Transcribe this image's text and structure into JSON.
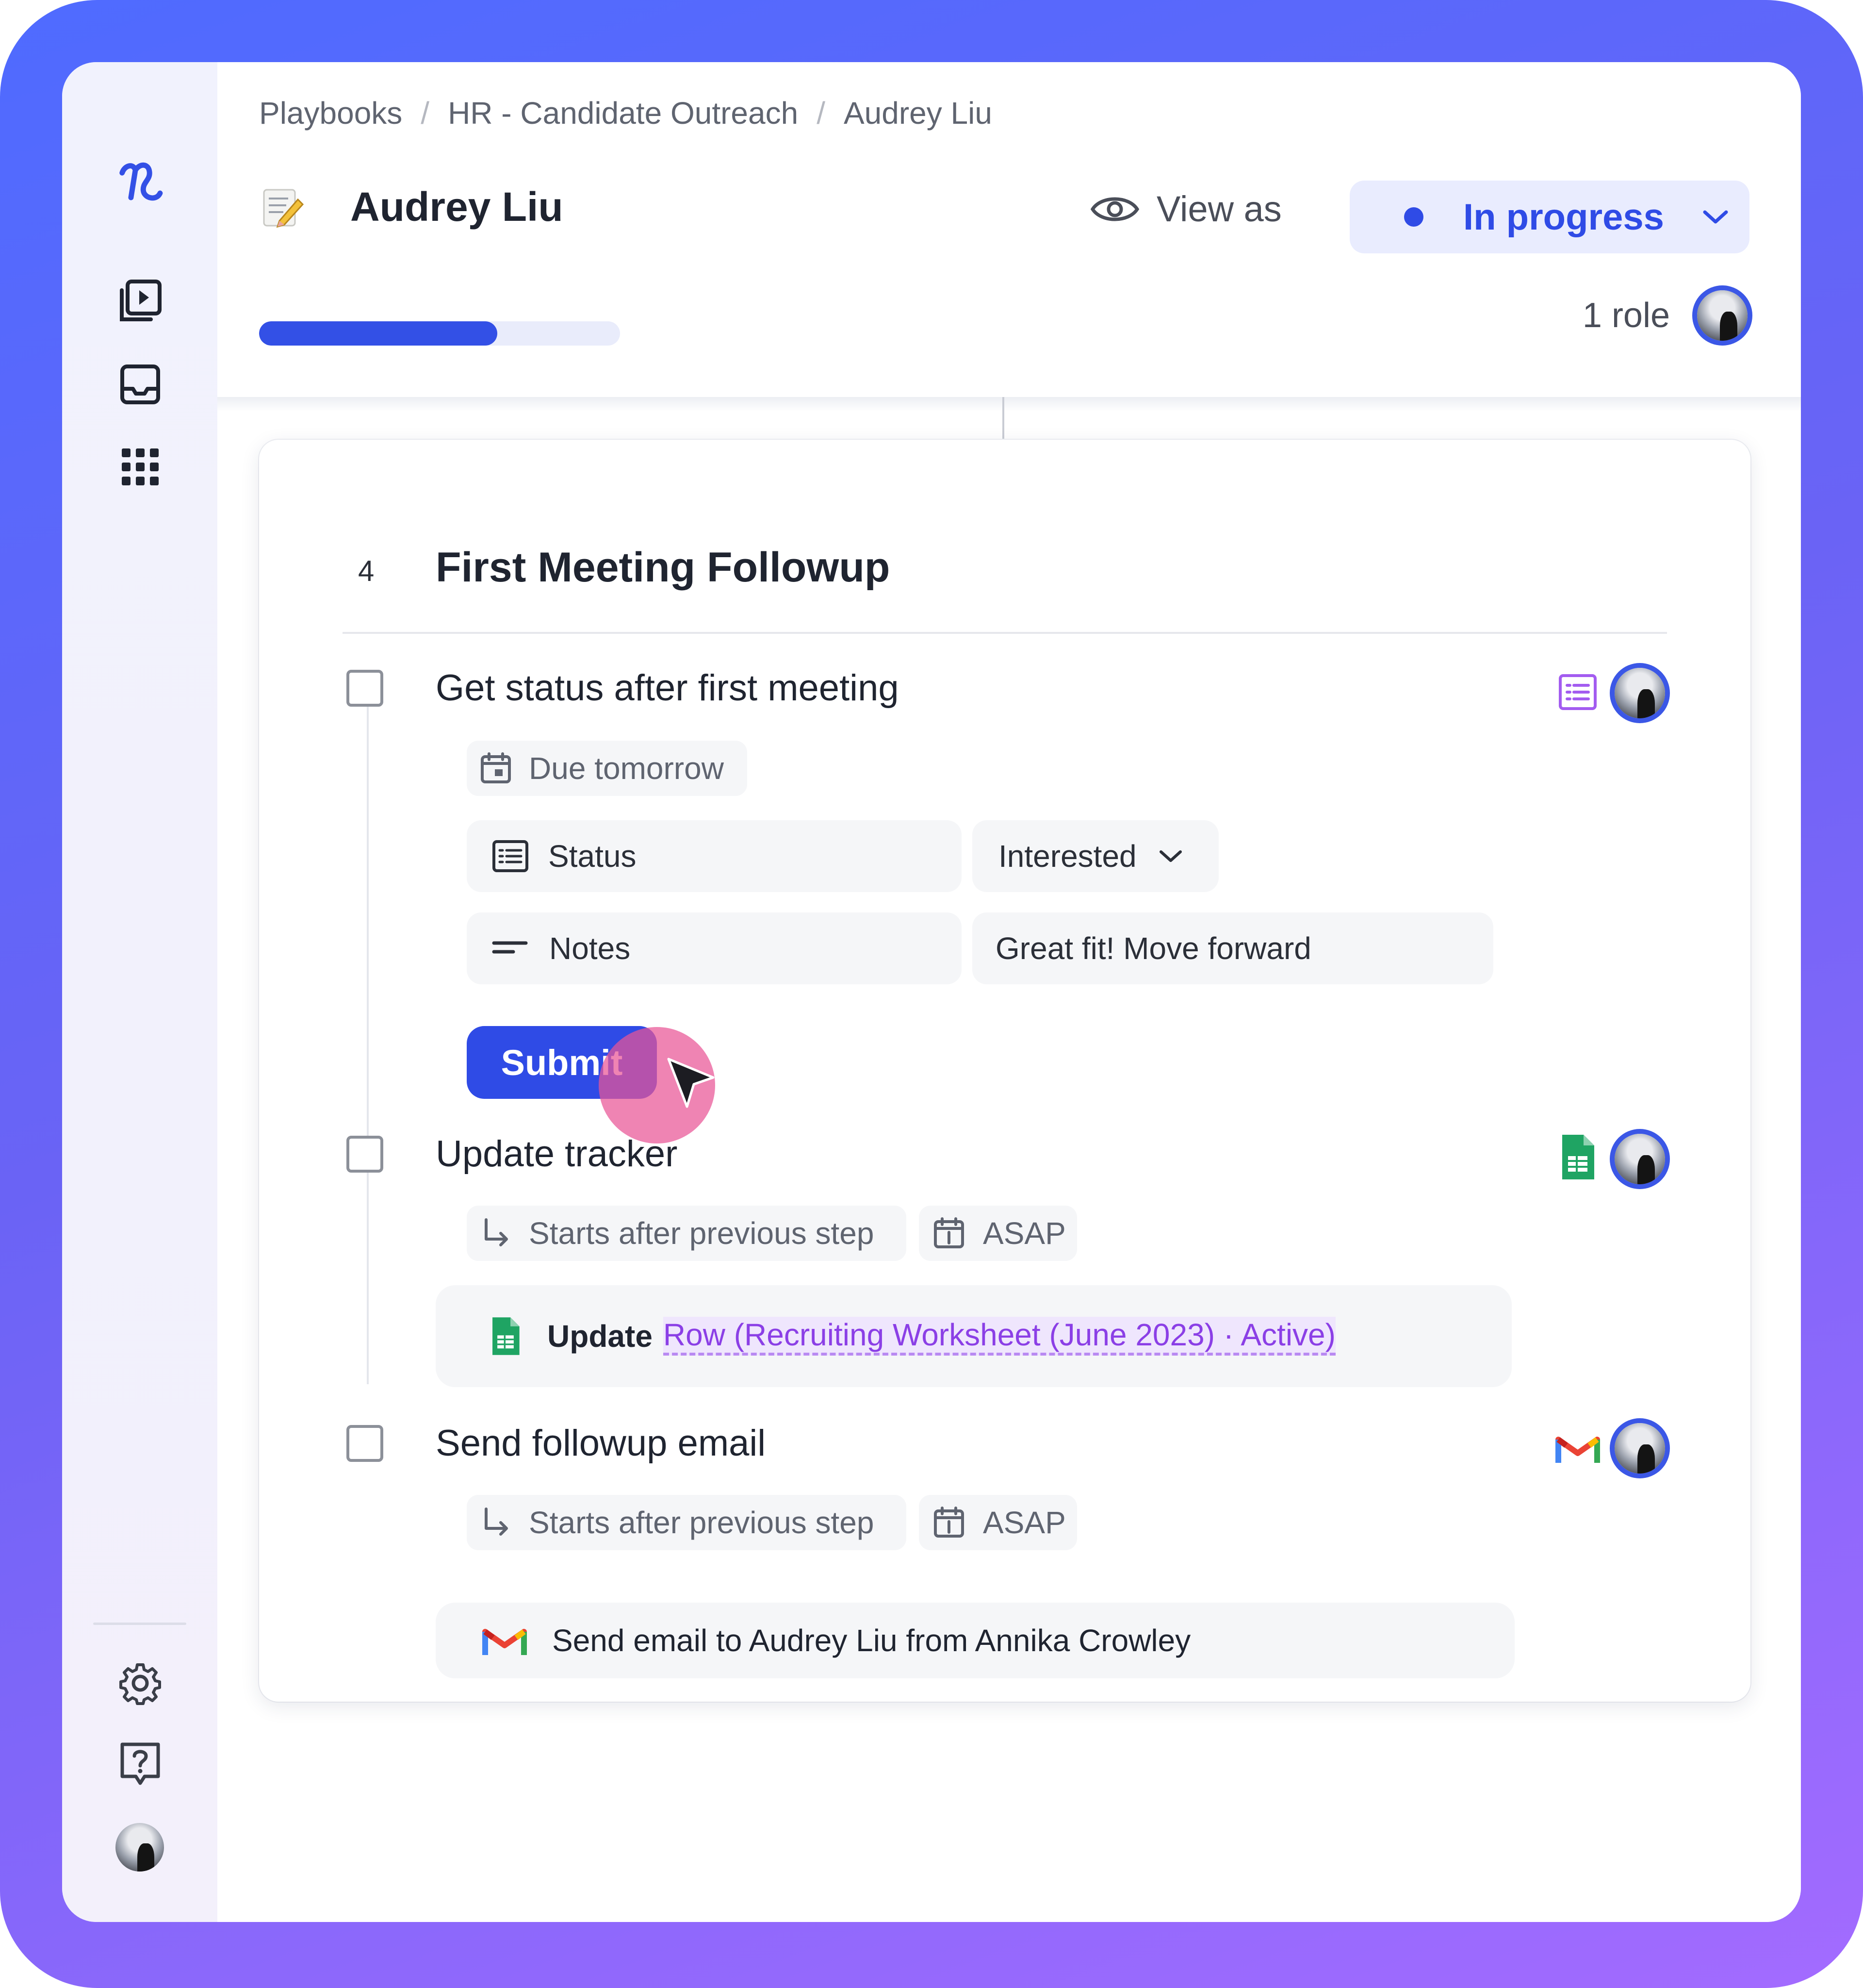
{
  "breadcrumb": [
    "Playbooks",
    "HR - Candidate Outreach",
    "Audrey Liu"
  ],
  "breadcrumb_separator": "/",
  "page": {
    "emoji": "📝",
    "title": "Audrey Liu"
  },
  "header": {
    "view_as_label": "View as",
    "status_label": "In progress",
    "roles_label": "1 role",
    "progress_fraction": 0.66
  },
  "section": {
    "number": "4",
    "title": "First Meeting Followup"
  },
  "steps": [
    {
      "title": "Get status after first meeting",
      "due_label": "Due tomorrow",
      "fields": [
        {
          "label": "Status",
          "value": "Interested"
        },
        {
          "label": "Notes",
          "value": "Great fit! Move forward"
        }
      ],
      "submit_label": "Submit"
    },
    {
      "title": "Update tracker",
      "starts_label": "Starts after previous step",
      "timing_label": "ASAP",
      "action_verb": "Update",
      "action_link": "Row (Recruiting Worksheet (June 2023) · Active)"
    },
    {
      "title": "Send followup email",
      "starts_label": "Starts after previous step",
      "timing_label": "ASAP",
      "action_text": "Send email to Audrey Liu from Annika Crowley"
    }
  ],
  "colors": {
    "accent": "#2f4be6",
    "sheets_green": "#1fa463",
    "form_purple": "#a35cf0",
    "cursor_pink": "#e95496"
  },
  "icons": [
    "logo-icon",
    "playbooks-icon",
    "inbox-icon",
    "apps-grid-icon",
    "settings-icon",
    "help-icon",
    "eye-icon",
    "chevron-down-icon",
    "calendar-icon",
    "form-icon",
    "notes-icon",
    "google-sheets-icon",
    "gmail-icon",
    "arrow-return-icon",
    "cursor-icon"
  ]
}
